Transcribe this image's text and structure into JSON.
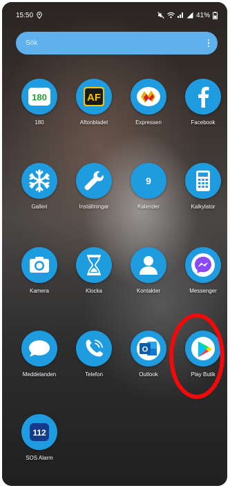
{
  "status_bar": {
    "time": "15:50",
    "battery": "41%"
  },
  "search": {
    "placeholder": "Sök"
  },
  "apps": [
    {
      "label": "180",
      "icon": "180-icon"
    },
    {
      "label": "Aftonbladet",
      "icon": "aftonbladet-icon"
    },
    {
      "label": "Expressen",
      "icon": "expressen-icon"
    },
    {
      "label": "Facebook",
      "icon": "facebook-icon"
    },
    {
      "label": "Galleri",
      "icon": "snowflake-icon"
    },
    {
      "label": "Inställningar",
      "icon": "wrench-icon"
    },
    {
      "label": "Kalender",
      "icon": "calendar-icon"
    },
    {
      "label": "Kalkylator",
      "icon": "calculator-icon"
    },
    {
      "label": "Kamera",
      "icon": "camera-icon"
    },
    {
      "label": "Klocka",
      "icon": "hourglass-icon"
    },
    {
      "label": "Kontakter",
      "icon": "person-icon"
    },
    {
      "label": "Messenger",
      "icon": "messenger-icon"
    },
    {
      "label": "Meddelanden",
      "icon": "chat-bubble-icon"
    },
    {
      "label": "Telefon",
      "icon": "phone-icon"
    },
    {
      "label": "Outlook",
      "icon": "outlook-icon"
    },
    {
      "label": "Play Butik",
      "icon": "play-store-icon"
    },
    {
      "label": "SOS Alarm",
      "icon": "sos-112-icon"
    }
  ],
  "icon_text": {
    "app_180": "180",
    "aftonbladet": "AF",
    "calendar_day": "9",
    "outlook_letter": "O",
    "sos_number": "112"
  },
  "colors": {
    "icon_blue": "#1f9be0",
    "search_blue": "#5fb1ee",
    "highlight_red": "#f20a0a"
  }
}
